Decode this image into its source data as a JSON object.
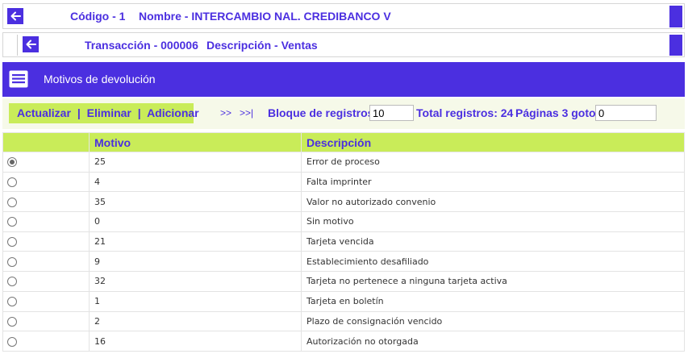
{
  "header1": {
    "codigo": "Código - 1",
    "nombre": "Nombre - INTERCAMBIO NAL. CREDIBANCO V"
  },
  "header2": {
    "transaccion": "Transacción - 000006",
    "descripcion": "Descripción - Ventas"
  },
  "panel": {
    "title": "Motivos de devolución",
    "icon": "list-document-icon"
  },
  "toolbar": {
    "actualizar": "Actualizar",
    "eliminar": "Eliminar",
    "adicionar": "Adicionar",
    "sep": "|",
    "next": ">>",
    "last": ">>|",
    "bloque_label": "Bloque de registros:",
    "bloque_value": "10",
    "total": "Total registros: 24",
    "paginas_label": "Páginas 3 goto:",
    "goto_value": "0"
  },
  "table": {
    "columns": [
      "",
      "Motivo",
      "Descripción"
    ],
    "rows": [
      {
        "selected": true,
        "motivo": "25",
        "descripcion": "Error de proceso"
      },
      {
        "selected": false,
        "motivo": "4",
        "descripcion": "Falta imprinter"
      },
      {
        "selected": false,
        "motivo": "35",
        "descripcion": "Valor no autorizado convenio"
      },
      {
        "selected": false,
        "motivo": "0",
        "descripcion": "Sin motivo"
      },
      {
        "selected": false,
        "motivo": "21",
        "descripcion": "Tarjeta vencida"
      },
      {
        "selected": false,
        "motivo": "9",
        "descripcion": "Establecimiento desafiliado"
      },
      {
        "selected": false,
        "motivo": "32",
        "descripcion": "Tarjeta no pertenece a ninguna tarjeta activa"
      },
      {
        "selected": false,
        "motivo": "1",
        "descripcion": "Tarjeta en boletín"
      },
      {
        "selected": false,
        "motivo": "2",
        "descripcion": "Plazo de consignación vencido"
      },
      {
        "selected": false,
        "motivo": "16",
        "descripcion": "Autorización no otorgada"
      }
    ]
  },
  "colors": {
    "accent": "#4b2fe0",
    "highlight": "#c9ec59",
    "toolbar_bg": "#f6f9e9"
  }
}
